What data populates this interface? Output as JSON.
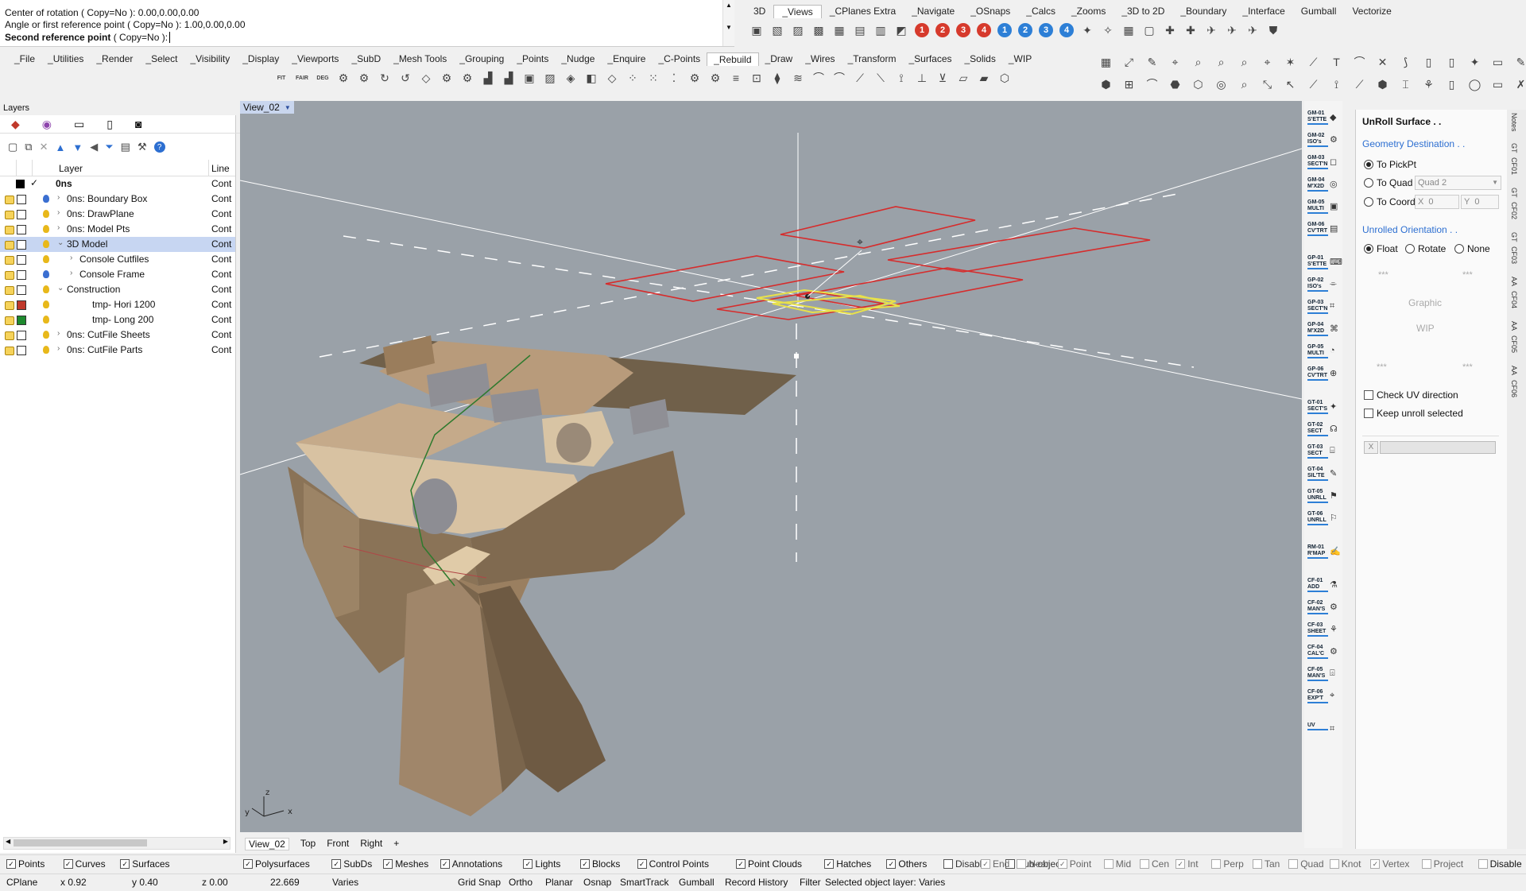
{
  "command": {
    "line1": "Center of rotation ( Copy=No ): 0.00,0.00,0.00",
    "line2": "Angle or first reference point ( Copy=No ): 1.00,0.00,0.00",
    "prompt_bold": "Second reference point",
    "prompt_rest": " ( Copy=No ):"
  },
  "top_tabs": [
    "3D",
    "_Views",
    "_CPlanes Extra",
    "_Navigate",
    "_OSnaps",
    "_Calcs",
    "_Zooms",
    "_3D to 2D",
    "_Boundary",
    "_Interface",
    "Gumball",
    "Vectorize"
  ],
  "main_tabs": [
    "_File",
    "_Utilities",
    "_Render",
    "_Select",
    "_Visibility",
    "_Display",
    "_Viewports",
    "_SubD",
    "_Mesh Tools",
    "_Grouping",
    "_Points",
    "_Nudge",
    "_Enquire",
    "_C-Points",
    "_Rebuild",
    "_Draw",
    "_Wires",
    "_Transform",
    "_Surfaces",
    "_Solids",
    "_WIP"
  ],
  "rebuild_icons": [
    "FIT",
    "FAIR",
    "DEG"
  ],
  "view_numbers": [
    "1",
    "2",
    "3",
    "4",
    "1",
    "2",
    "3",
    "4"
  ],
  "layers": {
    "title": "Layers",
    "col_layer": "Layer",
    "col_line": "Line",
    "rows": [
      {
        "name": "0ns",
        "line": "Cont",
        "indent": 0,
        "bold": true,
        "color": "#000000",
        "current": true
      },
      {
        "name": "0ns: Boundary Box",
        "line": "Cont",
        "indent": 1,
        "color": "#ffffff",
        "bulb": "#3b6fd1"
      },
      {
        "name": "0ns: DrawPlane",
        "line": "Cont",
        "indent": 1,
        "color": "#ffffff",
        "bulb": "#e8b81a"
      },
      {
        "name": "0ns: Model Pts",
        "line": "Cont",
        "indent": 1,
        "color": "#ffffff",
        "bulb": "#e8b81a"
      },
      {
        "name": "3D Model",
        "line": "Cont",
        "indent": 1,
        "color": "#ffffff",
        "bulb": "#e8b81a",
        "selected": true,
        "expanded": true
      },
      {
        "name": "Console Cutfiles",
        "line": "Cont",
        "indent": 2,
        "color": "#ffffff",
        "bulb": "#e8b81a"
      },
      {
        "name": "Console Frame",
        "line": "Cont",
        "indent": 2,
        "color": "#ffffff",
        "bulb": "#3b6fd1"
      },
      {
        "name": "Construction",
        "line": "Cont",
        "indent": 1,
        "color": "#ffffff",
        "bulb": "#e8b81a",
        "expanded": true
      },
      {
        "name": "tmp- Hori 1200",
        "line": "Cont",
        "indent": 3,
        "color": "#c0392b",
        "bulb": "#e8b81a"
      },
      {
        "name": "tmp- Long 200",
        "line": "Cont",
        "indent": 3,
        "color": "#1e8a2e",
        "bulb": "#e8b81a"
      },
      {
        "name": "0ns: CutFile Sheets",
        "line": "Cont",
        "indent": 1,
        "color": "#ffffff",
        "bulb": "#e8b81a"
      },
      {
        "name": "0ns: CutFile Parts",
        "line": "Cont",
        "indent": 1,
        "color": "#ffffff",
        "bulb": "#e8b81a"
      }
    ]
  },
  "viewport": {
    "name": "View_02",
    "axis_x": "x",
    "axis_y": "y",
    "axis_z": "z"
  },
  "viewport_tabs": [
    "View_02",
    "Top",
    "Front",
    "Right",
    "+"
  ],
  "side_buttons": [
    {
      "l1": "GM-01",
      "l2": "S'ETTE"
    },
    {
      "l1": "GM-02",
      "l2": "ISO's"
    },
    {
      "l1": "GM-03",
      "l2": "SECT'N"
    },
    {
      "l1": "GM-04",
      "l2": "M'X2D"
    },
    {
      "l1": "GM-05",
      "l2": "MULTI"
    },
    {
      "l1": "GM-06",
      "l2": "CV'TRT"
    },
    {
      "l1": "GP-01",
      "l2": "S'ETTE"
    },
    {
      "l1": "GP-02",
      "l2": "ISO's"
    },
    {
      "l1": "GP-03",
      "l2": "SECT'N"
    },
    {
      "l1": "GP-04",
      "l2": "M'X2D"
    },
    {
      "l1": "GP-05",
      "l2": "MULTI"
    },
    {
      "l1": "GP-06",
      "l2": "CV'TRT"
    },
    {
      "l1": "GT-01",
      "l2": "SECT'S"
    },
    {
      "l1": "GT-02",
      "l2": "SECT"
    },
    {
      "l1": "GT-03",
      "l2": "SECT"
    },
    {
      "l1": "GT-04",
      "l2": "SIL'TE"
    },
    {
      "l1": "GT-05",
      "l2": "UNRLL"
    },
    {
      "l1": "GT-06",
      "l2": "UNRLL"
    },
    {
      "l1": "RM-01",
      "l2": "R'MAP"
    },
    {
      "l1": "CF-01",
      "l2": "ADD"
    },
    {
      "l1": "CF-02",
      "l2": "MAN'S"
    },
    {
      "l1": "CF-03",
      "l2": "SHEET"
    },
    {
      "l1": "CF-04",
      "l2": "CAL'C"
    },
    {
      "l1": "CF-05",
      "l2": "MAN'S"
    },
    {
      "l1": "CF-06",
      "l2": "EXP'T"
    },
    {
      "l1": "UV",
      "l2": ""
    }
  ],
  "unroll": {
    "title": "UnRoll Surface . .",
    "geom_dest": "Geometry Destination . .",
    "to_pickpt": "To PickPt",
    "to_quad": "To Quad",
    "quad_value": "Quad 2",
    "to_coord": "To Coord",
    "coord_x_label": "X",
    "coord_x": "0",
    "coord_y_label": "Y",
    "coord_y": "0",
    "orientation": "Unrolled Orientation . .",
    "float": "Float",
    "rotate": "Rotate",
    "none": "None",
    "stars": "***",
    "graphic": "Graphic",
    "wip": "WIP",
    "check_uv": "Check UV direction",
    "keep_unroll": "Keep unroll selected",
    "x_btn": "X"
  },
  "far_tabs": [
    "Notes",
    "GT",
    "CF01",
    "GT",
    "CF02",
    "GT",
    "CF03",
    "AA",
    "CF04",
    "AA",
    "CF05",
    "AA",
    "CF06"
  ],
  "filters": [
    {
      "label": "Points",
      "checked": true
    },
    {
      "label": "Curves",
      "checked": true
    },
    {
      "label": "Surfaces",
      "checked": true
    },
    {
      "label": "Polysurfaces",
      "checked": true
    },
    {
      "label": "SubDs",
      "checked": true
    },
    {
      "label": "Meshes",
      "checked": true
    },
    {
      "label": "Annotations",
      "checked": true
    },
    {
      "label": "Lights",
      "checked": true
    },
    {
      "label": "Blocks",
      "checked": true
    },
    {
      "label": "Control Points",
      "checked": true
    },
    {
      "label": "Point Clouds",
      "checked": true
    },
    {
      "label": "Hatches",
      "checked": true
    },
    {
      "label": "Others",
      "checked": true
    },
    {
      "label": "Disable",
      "checked": false
    },
    {
      "label": "Sub-objects",
      "checked": false
    }
  ],
  "osnaps": [
    {
      "label": "End",
      "checked": true
    },
    {
      "label": "Near",
      "checked": false
    },
    {
      "label": "Point",
      "checked": true
    },
    {
      "label": "Mid",
      "checked": false
    },
    {
      "label": "Cen",
      "checked": false
    },
    {
      "label": "Int",
      "checked": true
    },
    {
      "label": "Perp",
      "checked": false
    },
    {
      "label": "Tan",
      "checked": false
    },
    {
      "label": "Quad",
      "checked": false
    },
    {
      "label": "Knot",
      "checked": false
    },
    {
      "label": "Vertex",
      "checked": true
    },
    {
      "label": "Project",
      "checked": false
    },
    {
      "label": "Disable",
      "checked": false
    }
  ],
  "status": {
    "cplane": "CPlane",
    "x": "x 0.92",
    "y": "y 0.40",
    "z": "z 0.00",
    "distance": "22.669",
    "layer": "Varies",
    "grid_snap": "Grid Snap",
    "ortho": "Ortho",
    "planar": "Planar",
    "osnap": "Osnap",
    "smarttrack": "SmartTrack",
    "gumball": "Gumball",
    "record_history": "Record History",
    "filter": "Filter",
    "message": "Selected object layer: Varies"
  }
}
